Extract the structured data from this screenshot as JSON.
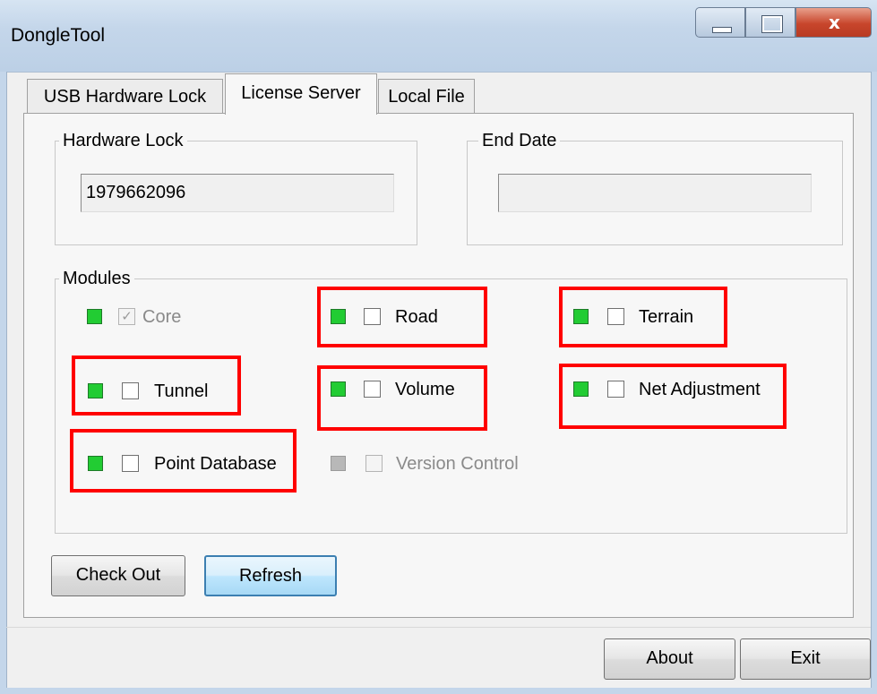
{
  "window": {
    "title": "DongleTool"
  },
  "caption_buttons": {
    "close_glyph": "x"
  },
  "tabs": [
    {
      "label": "USB Hardware Lock",
      "selected": false
    },
    {
      "label": "License Server",
      "selected": true
    },
    {
      "label": "Local File",
      "selected": false
    }
  ],
  "hardware_lock": {
    "group_label": "Hardware Lock",
    "value": "1979662096"
  },
  "end_date": {
    "group_label": "End Date",
    "value": ""
  },
  "modules": {
    "group_label": "Modules",
    "items": [
      {
        "label": "Core",
        "checked": true,
        "enabled": false,
        "led": "green",
        "highlighted": false
      },
      {
        "label": "Road",
        "checked": false,
        "enabled": true,
        "led": "green",
        "highlighted": true
      },
      {
        "label": "Terrain",
        "checked": false,
        "enabled": true,
        "led": "green",
        "highlighted": true
      },
      {
        "label": "Tunnel",
        "checked": false,
        "enabled": true,
        "led": "green",
        "highlighted": true
      },
      {
        "label": "Volume",
        "checked": false,
        "enabled": true,
        "led": "green",
        "highlighted": true
      },
      {
        "label": "Net Adjustment",
        "checked": false,
        "enabled": true,
        "led": "green",
        "highlighted": true
      },
      {
        "label": "Point Database",
        "checked": false,
        "enabled": true,
        "led": "green",
        "highlighted": true
      },
      {
        "label": "Version Control",
        "checked": false,
        "enabled": false,
        "led": "gray",
        "highlighted": false
      }
    ]
  },
  "buttons": {
    "check_out": "Check Out",
    "refresh": "Refresh",
    "about": "About",
    "exit": "Exit"
  },
  "colors": {
    "led_on": "#22cc33",
    "led_off": "#b8b8b8",
    "highlight": "#ff0000",
    "close_button": "#c8462c"
  }
}
